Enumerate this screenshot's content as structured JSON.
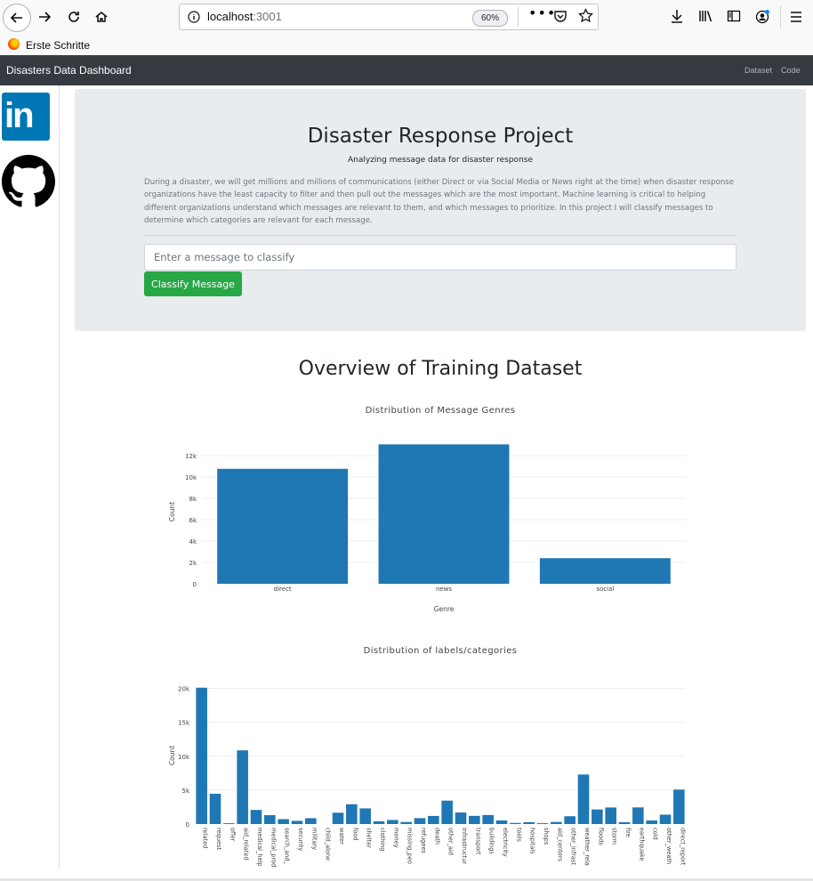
{
  "browser": {
    "url_host": "localhost",
    "url_port": ":3001",
    "zoom": "60%",
    "bookmark": "Erste Schritte"
  },
  "navbar": {
    "brand": "Disasters Data Dashboard",
    "links": [
      "Dataset",
      "Code"
    ]
  },
  "sidebar": {
    "linkedin_text": "in"
  },
  "jumbotron": {
    "title": "Disaster Response Project",
    "subtitle": "Analyzing message data for disaster response",
    "body": "During a disaster, we will get millions and millions of communications (either Direct or via Social Media or News right at the time) when disaster response organizations have the least capacity to filter and then pull out the messages which are the most important. Machine learning is critical to helping different organizations understand which messages are relevant to them, and which messages to prioritize. In this project I will classify messages to determine which categories are relevant for each message.",
    "input_placeholder": "Enter a message to classify",
    "button_label": "Classify Message"
  },
  "overview_title": "Overview of Training Dataset",
  "colors": {
    "bar": "#1f77b4",
    "grid": "#eeeeee",
    "button": "#28a745",
    "navbar": "#343a40"
  },
  "chart_data": [
    {
      "type": "bar",
      "title": "Distribution of Message Genres",
      "xlabel": "Genre",
      "ylabel": "Count",
      "categories": [
        "direct",
        "news",
        "social"
      ],
      "values": [
        10766,
        13054,
        2396
      ],
      "ylim": [
        0,
        13500
      ],
      "yticks": [
        0,
        2000,
        4000,
        6000,
        8000,
        10000,
        12000
      ],
      "ytick_labels": [
        "0",
        "2k",
        "4k",
        "6k",
        "8k",
        "10k",
        "12k"
      ],
      "grid": true
    },
    {
      "type": "bar",
      "title": "Distribution of labels/categories",
      "xlabel": "",
      "ylabel": "Count",
      "categories": [
        "related",
        "request",
        "offer",
        "aid_related",
        "medical_help",
        "medical_prod",
        "search_and_",
        "security",
        "military",
        "child_alone",
        "water",
        "food",
        "shelter",
        "clothing",
        "money",
        "missing_peo",
        "refugees",
        "death",
        "other_aid",
        "infrastructur",
        "transport",
        "buildings",
        "electricity",
        "tools",
        "hospitals",
        "shops",
        "aid_centers",
        "other_infrast",
        "weather_rela",
        "floods",
        "storm",
        "fire",
        "earthquake",
        "cold",
        "other_weath",
        "direct_report"
      ],
      "values": [
        20100,
        4470,
        120,
        10860,
        2080,
        1310,
        720,
        470,
        860,
        0,
        1670,
        2920,
        2310,
        400,
        600,
        300,
        870,
        1190,
        3450,
        1700,
        1200,
        1330,
        530,
        160,
        280,
        120,
        310,
        1150,
        7300,
        2150,
        2440,
        280,
        2450,
        530,
        1380,
        5080
      ],
      "ylim": [
        0,
        20200
      ],
      "yticks": [
        0,
        5000,
        10000,
        15000,
        20000
      ],
      "ytick_labels": [
        "0",
        "5k",
        "10k",
        "15k",
        "20k"
      ],
      "grid": true
    }
  ]
}
